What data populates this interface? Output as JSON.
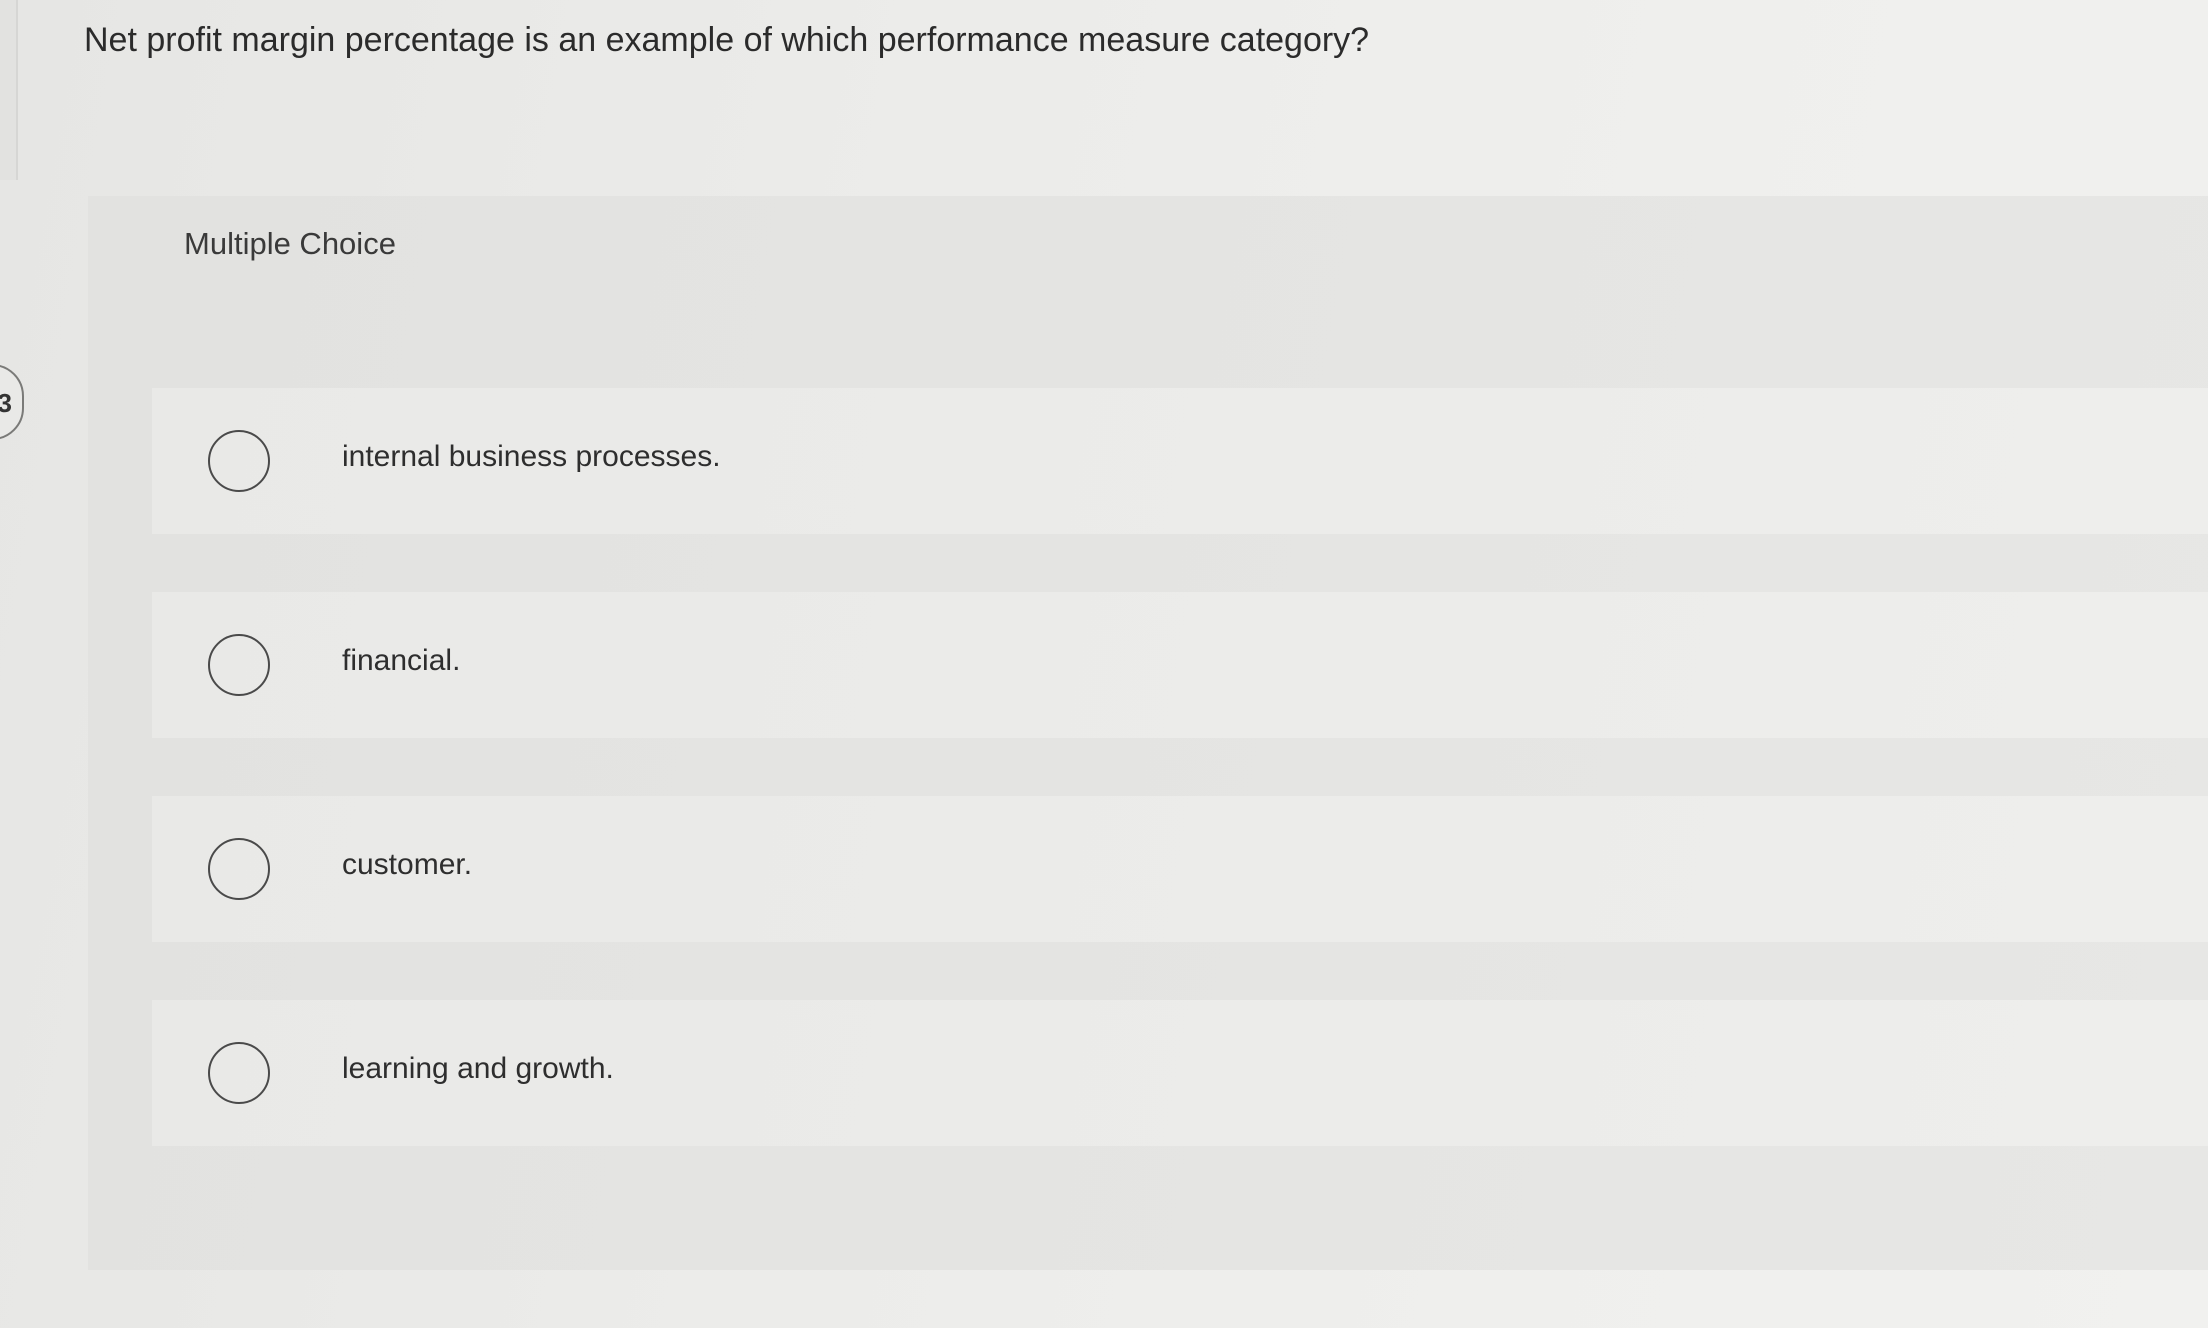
{
  "question": {
    "text": "Net profit margin percentage is an example of which performance measure category?"
  },
  "side_tab": {
    "label": "3"
  },
  "multiple_choice": {
    "label": "Multiple Choice",
    "options": [
      {
        "label": "internal business processes."
      },
      {
        "label": "financial."
      },
      {
        "label": "customer."
      },
      {
        "label": "learning and growth."
      }
    ]
  }
}
